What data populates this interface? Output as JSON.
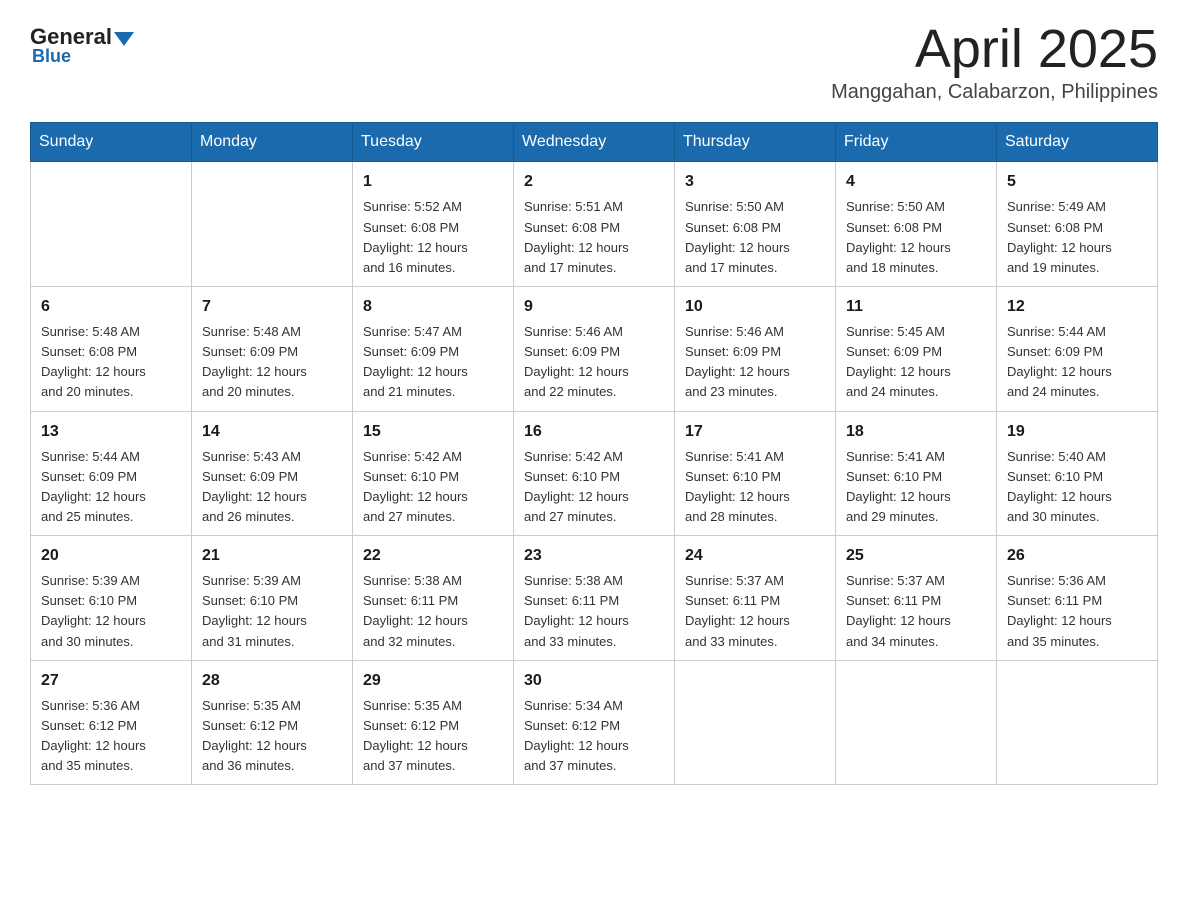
{
  "header": {
    "title": "April 2025",
    "subtitle": "Manggahan, Calabarzon, Philippines",
    "logo_general": "General",
    "logo_blue": "Blue"
  },
  "days_of_week": [
    "Sunday",
    "Monday",
    "Tuesday",
    "Wednesday",
    "Thursday",
    "Friday",
    "Saturday"
  ],
  "weeks": [
    [
      {
        "day": "",
        "info": ""
      },
      {
        "day": "",
        "info": ""
      },
      {
        "day": "1",
        "info": "Sunrise: 5:52 AM\nSunset: 6:08 PM\nDaylight: 12 hours\nand 16 minutes."
      },
      {
        "day": "2",
        "info": "Sunrise: 5:51 AM\nSunset: 6:08 PM\nDaylight: 12 hours\nand 17 minutes."
      },
      {
        "day": "3",
        "info": "Sunrise: 5:50 AM\nSunset: 6:08 PM\nDaylight: 12 hours\nand 17 minutes."
      },
      {
        "day": "4",
        "info": "Sunrise: 5:50 AM\nSunset: 6:08 PM\nDaylight: 12 hours\nand 18 minutes."
      },
      {
        "day": "5",
        "info": "Sunrise: 5:49 AM\nSunset: 6:08 PM\nDaylight: 12 hours\nand 19 minutes."
      }
    ],
    [
      {
        "day": "6",
        "info": "Sunrise: 5:48 AM\nSunset: 6:08 PM\nDaylight: 12 hours\nand 20 minutes."
      },
      {
        "day": "7",
        "info": "Sunrise: 5:48 AM\nSunset: 6:09 PM\nDaylight: 12 hours\nand 20 minutes."
      },
      {
        "day": "8",
        "info": "Sunrise: 5:47 AM\nSunset: 6:09 PM\nDaylight: 12 hours\nand 21 minutes."
      },
      {
        "day": "9",
        "info": "Sunrise: 5:46 AM\nSunset: 6:09 PM\nDaylight: 12 hours\nand 22 minutes."
      },
      {
        "day": "10",
        "info": "Sunrise: 5:46 AM\nSunset: 6:09 PM\nDaylight: 12 hours\nand 23 minutes."
      },
      {
        "day": "11",
        "info": "Sunrise: 5:45 AM\nSunset: 6:09 PM\nDaylight: 12 hours\nand 24 minutes."
      },
      {
        "day": "12",
        "info": "Sunrise: 5:44 AM\nSunset: 6:09 PM\nDaylight: 12 hours\nand 24 minutes."
      }
    ],
    [
      {
        "day": "13",
        "info": "Sunrise: 5:44 AM\nSunset: 6:09 PM\nDaylight: 12 hours\nand 25 minutes."
      },
      {
        "day": "14",
        "info": "Sunrise: 5:43 AM\nSunset: 6:09 PM\nDaylight: 12 hours\nand 26 minutes."
      },
      {
        "day": "15",
        "info": "Sunrise: 5:42 AM\nSunset: 6:10 PM\nDaylight: 12 hours\nand 27 minutes."
      },
      {
        "day": "16",
        "info": "Sunrise: 5:42 AM\nSunset: 6:10 PM\nDaylight: 12 hours\nand 27 minutes."
      },
      {
        "day": "17",
        "info": "Sunrise: 5:41 AM\nSunset: 6:10 PM\nDaylight: 12 hours\nand 28 minutes."
      },
      {
        "day": "18",
        "info": "Sunrise: 5:41 AM\nSunset: 6:10 PM\nDaylight: 12 hours\nand 29 minutes."
      },
      {
        "day": "19",
        "info": "Sunrise: 5:40 AM\nSunset: 6:10 PM\nDaylight: 12 hours\nand 30 minutes."
      }
    ],
    [
      {
        "day": "20",
        "info": "Sunrise: 5:39 AM\nSunset: 6:10 PM\nDaylight: 12 hours\nand 30 minutes."
      },
      {
        "day": "21",
        "info": "Sunrise: 5:39 AM\nSunset: 6:10 PM\nDaylight: 12 hours\nand 31 minutes."
      },
      {
        "day": "22",
        "info": "Sunrise: 5:38 AM\nSunset: 6:11 PM\nDaylight: 12 hours\nand 32 minutes."
      },
      {
        "day": "23",
        "info": "Sunrise: 5:38 AM\nSunset: 6:11 PM\nDaylight: 12 hours\nand 33 minutes."
      },
      {
        "day": "24",
        "info": "Sunrise: 5:37 AM\nSunset: 6:11 PM\nDaylight: 12 hours\nand 33 minutes."
      },
      {
        "day": "25",
        "info": "Sunrise: 5:37 AM\nSunset: 6:11 PM\nDaylight: 12 hours\nand 34 minutes."
      },
      {
        "day": "26",
        "info": "Sunrise: 5:36 AM\nSunset: 6:11 PM\nDaylight: 12 hours\nand 35 minutes."
      }
    ],
    [
      {
        "day": "27",
        "info": "Sunrise: 5:36 AM\nSunset: 6:12 PM\nDaylight: 12 hours\nand 35 minutes."
      },
      {
        "day": "28",
        "info": "Sunrise: 5:35 AM\nSunset: 6:12 PM\nDaylight: 12 hours\nand 36 minutes."
      },
      {
        "day": "29",
        "info": "Sunrise: 5:35 AM\nSunset: 6:12 PM\nDaylight: 12 hours\nand 37 minutes."
      },
      {
        "day": "30",
        "info": "Sunrise: 5:34 AM\nSunset: 6:12 PM\nDaylight: 12 hours\nand 37 minutes."
      },
      {
        "day": "",
        "info": ""
      },
      {
        "day": "",
        "info": ""
      },
      {
        "day": "",
        "info": ""
      }
    ]
  ]
}
